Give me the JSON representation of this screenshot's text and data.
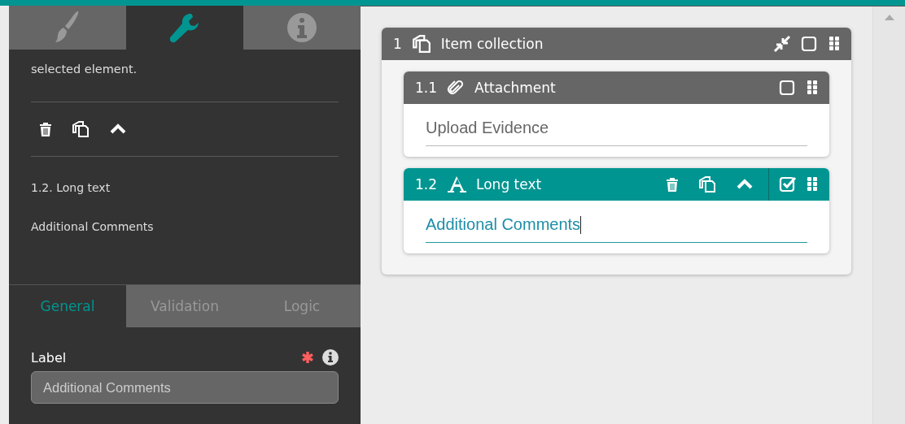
{
  "panel_tabs": [
    {
      "kind": "brush",
      "selected": false
    },
    {
      "kind": "wrench",
      "selected": true
    },
    {
      "kind": "info",
      "selected": false
    }
  ],
  "description": "selected element.",
  "element_path": "1.2. Long text",
  "element_label": "Additional Comments",
  "settings_tabs": [
    {
      "label": "General",
      "selected": true
    },
    {
      "label": "Validation",
      "selected": false
    },
    {
      "label": "Logic",
      "selected": false
    }
  ],
  "fields": [
    {
      "label": "Label",
      "required": true,
      "value": "Additional Comments"
    }
  ],
  "collection": {
    "number": "1",
    "title": "Item collection",
    "checked": false,
    "items": [
      {
        "number": "1.1",
        "kind": "attachment",
        "title": "Attachment",
        "selected": false,
        "checked": false,
        "text": "Upload Evidence"
      },
      {
        "number": "1.2",
        "kind": "long_text",
        "title": "Long text",
        "selected": true,
        "checked": true,
        "text": "Additional Comments"
      }
    ]
  }
}
